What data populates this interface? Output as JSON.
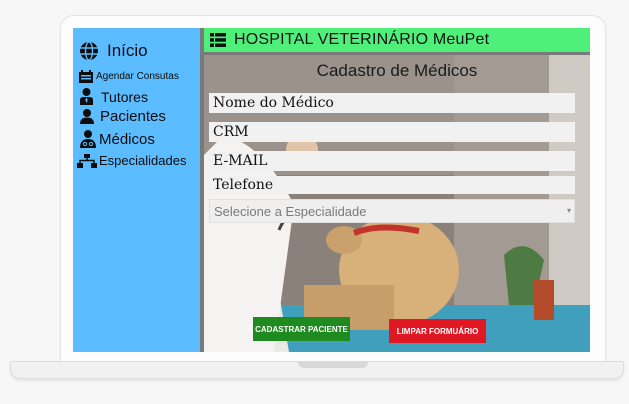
{
  "sidebar": {
    "items": [
      {
        "label": "Início",
        "icon": "globe-icon"
      },
      {
        "label": "Agendar Consutas",
        "icon": "calendar-icon"
      },
      {
        "label": "Tutores",
        "icon": "user-tie-icon"
      },
      {
        "label": "Pacientes",
        "icon": "user-icon"
      },
      {
        "label": "Médicos",
        "icon": "doctor-icon"
      },
      {
        "label": "Especialidades",
        "icon": "sitemap-icon"
      }
    ]
  },
  "header": {
    "title": "HOSPITAL VETERINÁRIO MeuPet",
    "icon": "list-icon",
    "color": "#4ff07a"
  },
  "form": {
    "title": "Cadastro de Médicos",
    "fields": {
      "nome": {
        "placeholder": "Nome do Médico"
      },
      "crm": {
        "placeholder": "CRM"
      },
      "email": {
        "placeholder": "E-MAIL"
      },
      "telefone": {
        "placeholder": "Telefone"
      }
    },
    "specialty_select": {
      "selected": "Selecione a Especialidade"
    },
    "submit_label": "CADASTRAR PACIENTE",
    "clear_label": "LIMPAR FORMUÁRIO"
  },
  "colors": {
    "sidebar": "#5bbcff",
    "header": "#4ff07a",
    "submit": "#1f8a20",
    "clear": "#e01824"
  }
}
